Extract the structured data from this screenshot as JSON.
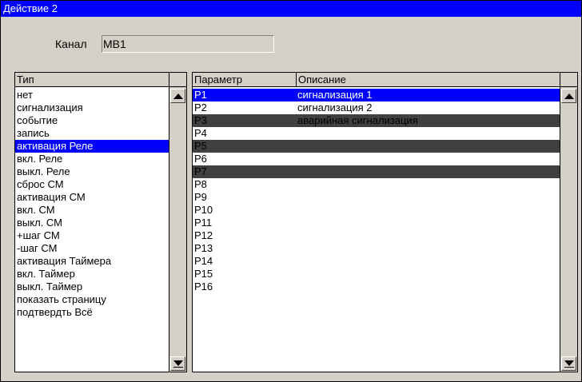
{
  "window": {
    "title": "Действие 2"
  },
  "channel": {
    "label": "Канал",
    "value": "MB1"
  },
  "type_list": {
    "header": "Тип",
    "items": [
      "нет",
      "сигнализация",
      "событие",
      "запись",
      "активация Реле",
      "вкл. Реле",
      "выкл. Реле",
      "сброс СМ",
      "активация СМ",
      "вкл. СМ",
      "выкл. СМ",
      "+шаг СМ",
      "-шаг СМ",
      "активация Таймера",
      "вкл. Таймер",
      "выкл. Таймер",
      "показать страницу",
      "подтвердть Всё"
    ],
    "selected_index": 4
  },
  "param_list": {
    "header_param": "Параметр",
    "header_desc": "Описание",
    "rows": [
      {
        "param": "P1",
        "desc": "сигнализация 1",
        "state": "selected"
      },
      {
        "param": "P2",
        "desc": "сигнализация 2",
        "state": "normal"
      },
      {
        "param": "P3",
        "desc": "аварийная сигнализация",
        "state": "dark"
      },
      {
        "param": "P4",
        "desc": "",
        "state": "normal"
      },
      {
        "param": "P5",
        "desc": "",
        "state": "dark"
      },
      {
        "param": "P6",
        "desc": "",
        "state": "normal"
      },
      {
        "param": "P7",
        "desc": "",
        "state": "dark"
      },
      {
        "param": "P8",
        "desc": "",
        "state": "normal"
      },
      {
        "param": "P9",
        "desc": "",
        "state": "normal"
      },
      {
        "param": "P10",
        "desc": "",
        "state": "normal"
      },
      {
        "param": "P11",
        "desc": "",
        "state": "normal"
      },
      {
        "param": "P12",
        "desc": "",
        "state": "normal"
      },
      {
        "param": "P13",
        "desc": "",
        "state": "normal"
      },
      {
        "param": "P14",
        "desc": "",
        "state": "normal"
      },
      {
        "param": "P15",
        "desc": "",
        "state": "normal"
      },
      {
        "param": "P16",
        "desc": "",
        "state": "normal"
      }
    ]
  },
  "colors": {
    "selection": "#0000ff",
    "dark_row": "#404040",
    "window_bg": "#d4d0c8"
  },
  "icons": {
    "scroll_up": "arrow-up-icon",
    "scroll_down": "arrow-down-icon"
  }
}
